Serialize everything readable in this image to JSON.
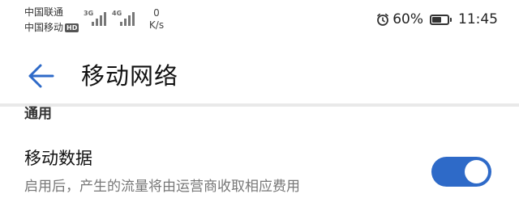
{
  "status_bar": {
    "carrier_primary": "中国联通",
    "carrier_secondary": "中国移动",
    "hd_badge": "HD",
    "signal_primary_type": "3G",
    "signal_secondary_type": "4G",
    "net_speed_value": "0",
    "net_speed_unit": "K/s",
    "alarm_icon": "alarm-clock-icon",
    "battery_percent": "60%",
    "battery_level": 0.6,
    "time": "11:45"
  },
  "header": {
    "back_icon": "back-arrow-icon",
    "title": "移动网络",
    "accent_color": "#2e6ac8"
  },
  "section": {
    "header": "通用",
    "items": [
      {
        "title": "移动数据",
        "subtitle": "启用后，产生的流量将由运营商收取相应费用",
        "toggle_on": true
      }
    ]
  }
}
